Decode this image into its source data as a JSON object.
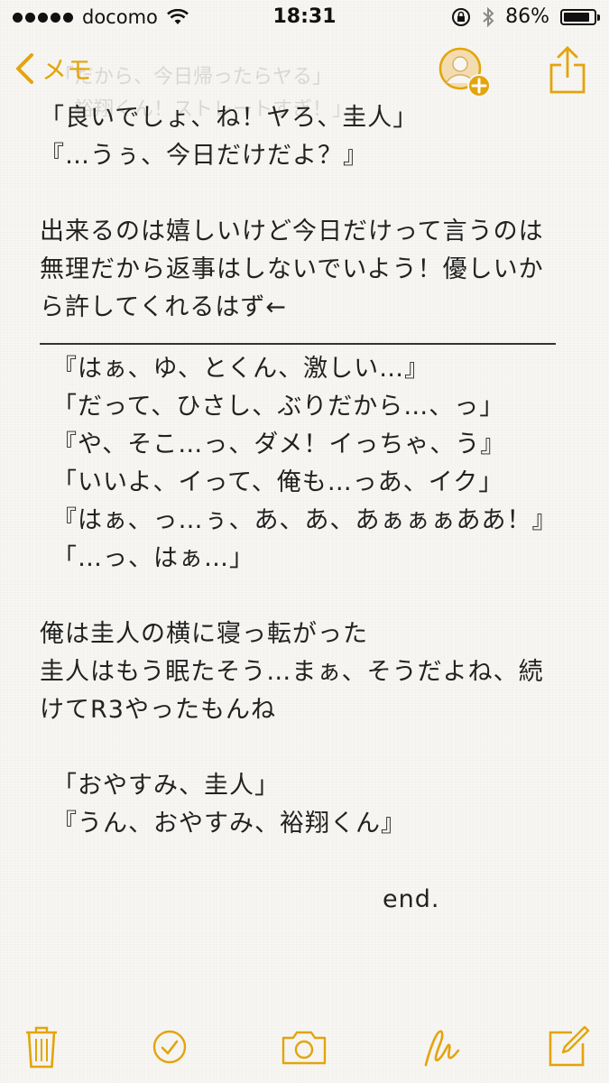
{
  "status_bar": {
    "carrier": "docomo",
    "time": "18:31",
    "battery_percent": "86%",
    "battery_level": 0.86
  },
  "nav": {
    "back_label": "メモ",
    "ghost_lines": [
      "「だから、今日帰ったらヤる」",
      "　裕翔くん！ストレートすぎ！」"
    ]
  },
  "note": {
    "lines": [
      "「良いでしょ、ね！ヤろ、圭人」",
      "『…うぅ、今日だけだよ？』",
      "",
      "出来るのは嬉しいけど今日だけって言うのは",
      "無理だから返事はしないでいよう！優しいか",
      "ら許してくれるはず←"
    ],
    "lines_after_divider": [
      "『はぁ、ゆ、とくん、激しい…』",
      "「だって、ひさし、ぶりだから…、っ」",
      "『や、そこ…っ、ダメ！イっちゃ、う』",
      "「いいよ、イって、俺も…っあ、イク」",
      "『はぁ、っ…ぅ、あ、あ、あぁぁぁああ！』",
      "「…っ、はぁ…」"
    ],
    "lines_part3": [
      "俺は圭人の横に寝っ転がった",
      "圭人はもう眠たそう…まぁ、そうだよね、続",
      "けてR3やったもんね"
    ],
    "lines_part4": [
      "「おやすみ、圭人」",
      "『うん、おやすみ、裕翔くん』"
    ],
    "end_text": "end."
  },
  "icons": {
    "back": "chevron-left-icon",
    "contact": "add-contact-icon",
    "share": "share-icon",
    "trash": "trash-icon",
    "checklist": "checkmark-circle-icon",
    "camera": "camera-icon",
    "sketch": "sketch-icon",
    "compose": "compose-icon"
  },
  "colors": {
    "accent": "#e3a40c",
    "text": "#222222",
    "paper": "#f7f6f2"
  }
}
